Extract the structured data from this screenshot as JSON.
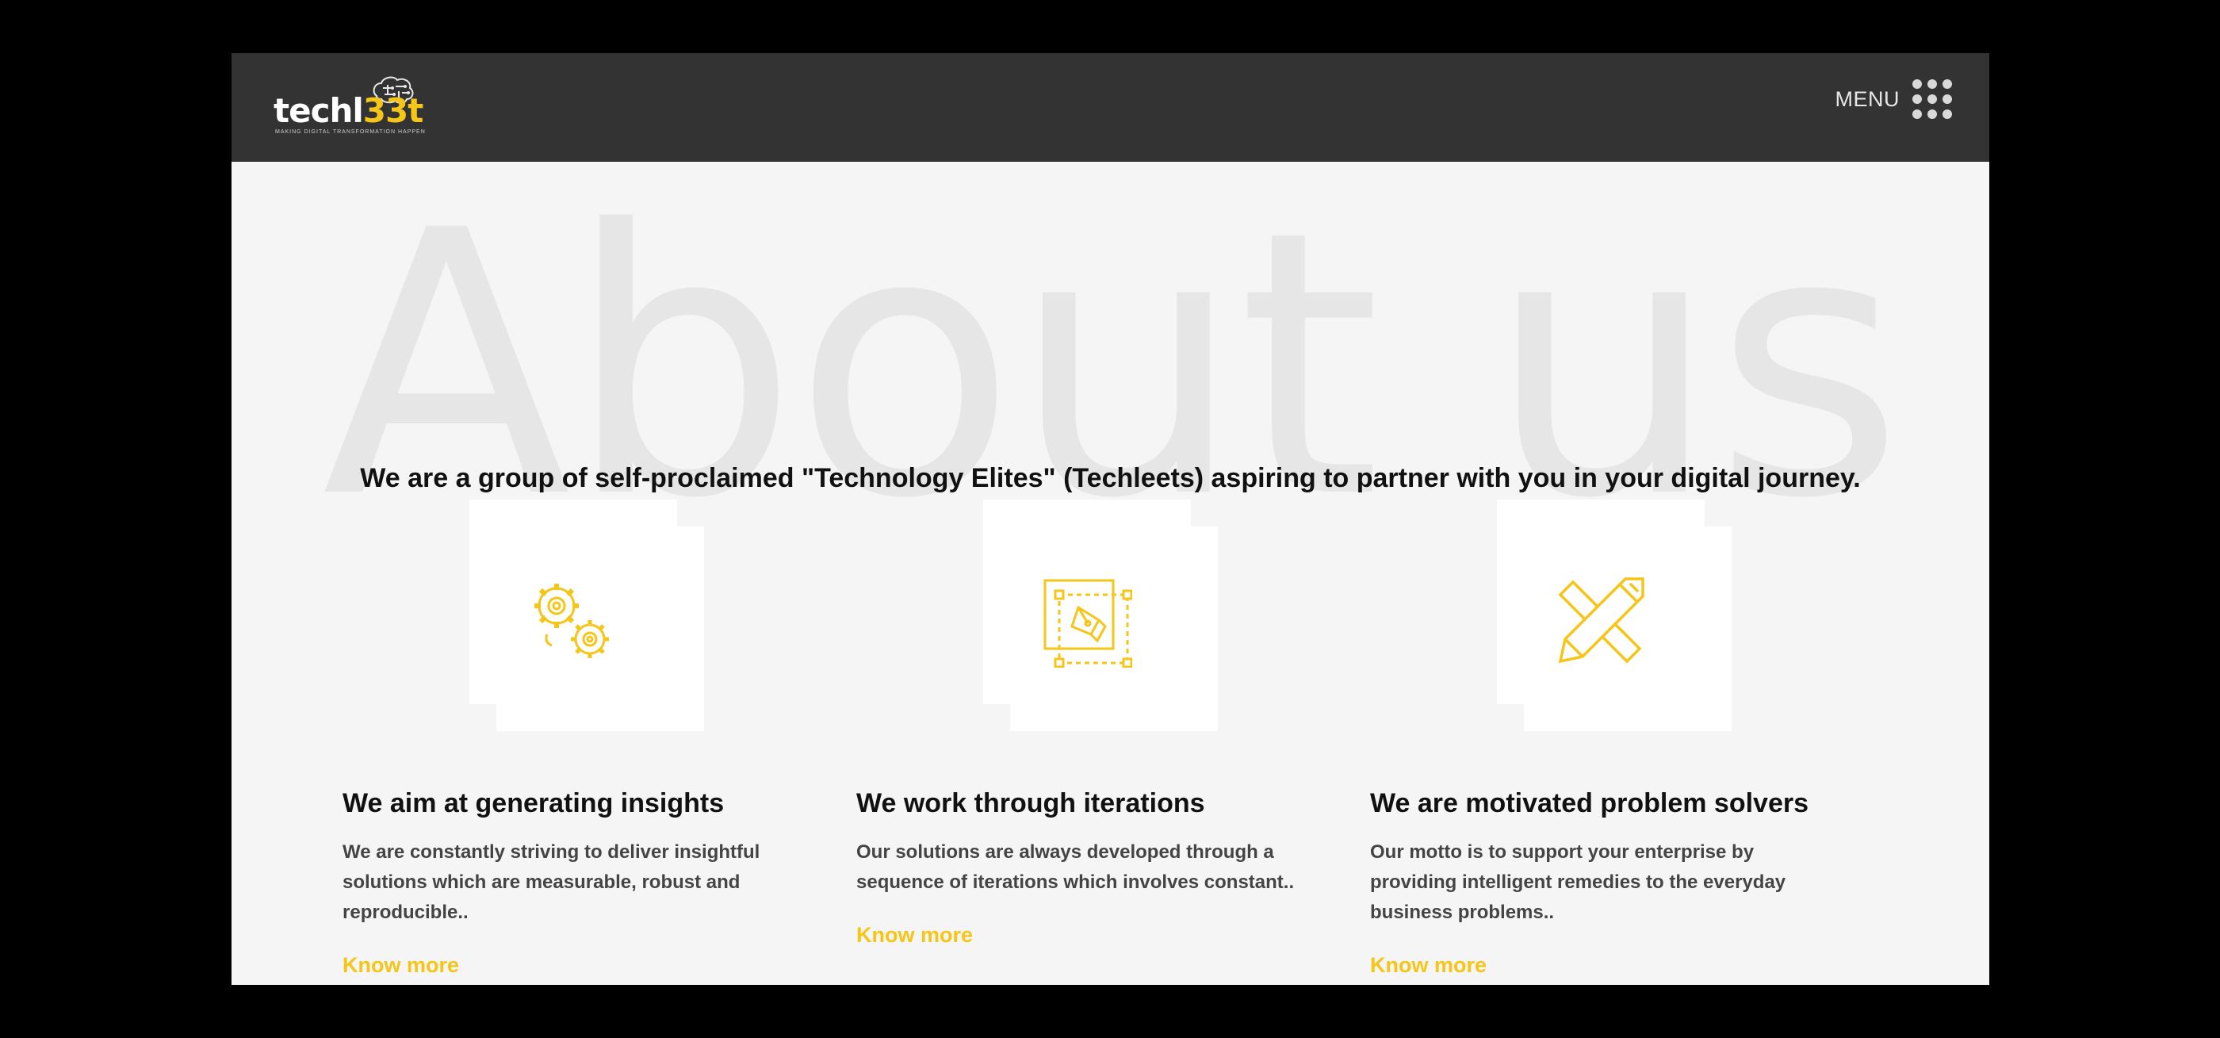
{
  "header": {
    "logo": {
      "text_main": "techl",
      "text_accent": "33t",
      "tagline": "MAKING DIGITAL TRANSFORMATION HAPPEN"
    },
    "menu_label": "MENU"
  },
  "hero": {
    "background_title": "About us",
    "tagline": "We are a group of self-proclaimed \"Technology Elites\" (Techleets) aspiring to partner with you in your digital journey."
  },
  "features": [
    {
      "icon": "gears-icon",
      "title": "We aim at generating insights",
      "text": "We are constantly striving to deliver insightful solutions which are measurable, robust and reproducible..",
      "link": "Know more"
    },
    {
      "icon": "design-pen-icon",
      "title": "We work through iterations",
      "text": "Our solutions are always developed through a sequence of iterations which involves constant..",
      "link": "Know more"
    },
    {
      "icon": "pencil-ruler-icon",
      "title": "We are motivated problem solvers",
      "text": "Our motto is to support your enterprise by providing intelligent remedies to the everyday business problems..",
      "link": "Know more"
    }
  ],
  "colors": {
    "accent": "#f5c518",
    "header_bg": "#333333",
    "page_bg": "#f5f5f5",
    "outer_bg": "#000000"
  }
}
